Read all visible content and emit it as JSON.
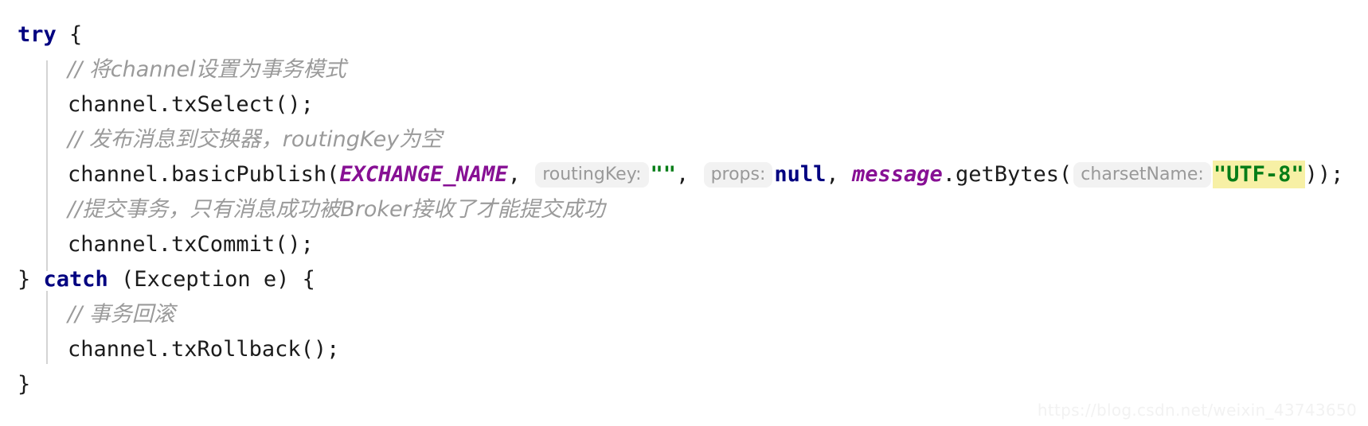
{
  "editor": {
    "language": "java",
    "background_color": "#ffffff",
    "theme": "IntelliJ Light",
    "watermark": "https://blog.csdn.net/weixin_43743650",
    "colors": {
      "keyword": "#000080",
      "comment": "#9a9a9a",
      "string": "#067d17",
      "constant": "#871094",
      "local_variable": "#871094",
      "plain_text": "#1b1b1b",
      "parameter_hint_text": "#999999",
      "parameter_hint_background": "#f2f2f2",
      "search_highlight_background": "#f7f0a5",
      "indent_guide": "#d4d4d4",
      "watermark": "#f2f2f2"
    }
  },
  "code": {
    "line1": {
      "keyword_try": "try",
      "brace_open": " {"
    },
    "line2": {
      "comment": "// 将channel设置为事务模式"
    },
    "line3": {
      "statement": "channel.txSelect();"
    },
    "line4": {
      "comment": "// 发布消息到交换器，routingKey为空"
    },
    "line5": {
      "call_prefix": "channel.basicPublish(",
      "arg_exchange_name": "EXCHANGE_NAME",
      "comma1": ", ",
      "hint_routing_key": "routingKey:",
      "arg_empty_string": "\"\"",
      "comma2": ", ",
      "hint_props": "props:",
      "arg_null": "null",
      "comma3": ", ",
      "arg_message_var": "message",
      "get_bytes_call": ".getBytes(",
      "hint_charset_name": "charsetName:",
      "arg_utf8": "\"UTF-8\"",
      "call_suffix": "));"
    },
    "line6": {
      "comment": "//提交事务，只有消息成功被Broker接收了才能提交成功"
    },
    "line7": {
      "statement": "channel.txCommit();"
    },
    "line8": {
      "brace_close": "} ",
      "keyword_catch": "catch",
      "exception_clause": " (Exception e) {"
    },
    "line9": {
      "comment": "// 事务回滚"
    },
    "line10": {
      "statement": "channel.txRollback();"
    },
    "line11": {
      "brace_close": "}"
    }
  }
}
